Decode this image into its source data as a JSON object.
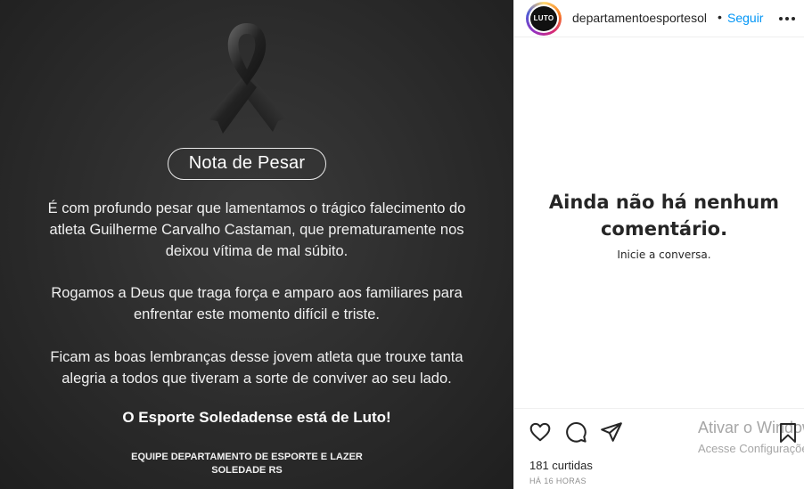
{
  "post": {
    "nota_title": "Nota de Pesar",
    "paragraph1_lines": [
      "É com profundo pesar que lamentamos o trágico falecimento do",
      "atleta Guilherme Carvalho Castaman, que prematuramente nos",
      "deixou vítima de mal súbito."
    ],
    "paragraph2_lines": [
      "Rogamos a Deus que traga força e amparo aos familiares para",
      "enfrentar este momento difícil e triste."
    ],
    "paragraph3_lines": [
      "Ficam as boas lembranças desse jovem atleta que trouxe tanta",
      "alegria a todos que tiveram a sorte de conviver ao seu lado."
    ],
    "luto_line": "O Esporte Soledadense está de Luto!",
    "footer_line1": "EQUIPE DEPARTAMENTO DE ESPORTE E LAZER",
    "footer_line2": "SOLEDADE RS"
  },
  "header": {
    "avatar_text": "LUTO",
    "username": "departamentoesportesol",
    "separator": "•",
    "follow_label": "Seguir",
    "more_icon": "more-horizontal-icon"
  },
  "comments": {
    "empty_title_line1": "Ainda não há nenhum",
    "empty_title_line2": "comentário.",
    "empty_subtitle": "Inicie a conversa."
  },
  "actions": {
    "icons": [
      "heart-icon",
      "comment-icon",
      "share-icon",
      "bookmark-icon"
    ],
    "likes": "181 curtidas",
    "timestamp": "HÁ 16 HORAS"
  },
  "windows_watermark": {
    "title": "Ativar o Windows",
    "subtitle": "Acesse Configurações"
  },
  "colors": {
    "link_blue": "#0095f6",
    "post_background": "#2b2b2b",
    "text_dark": "#262626",
    "muted": "#8e8e8e"
  }
}
